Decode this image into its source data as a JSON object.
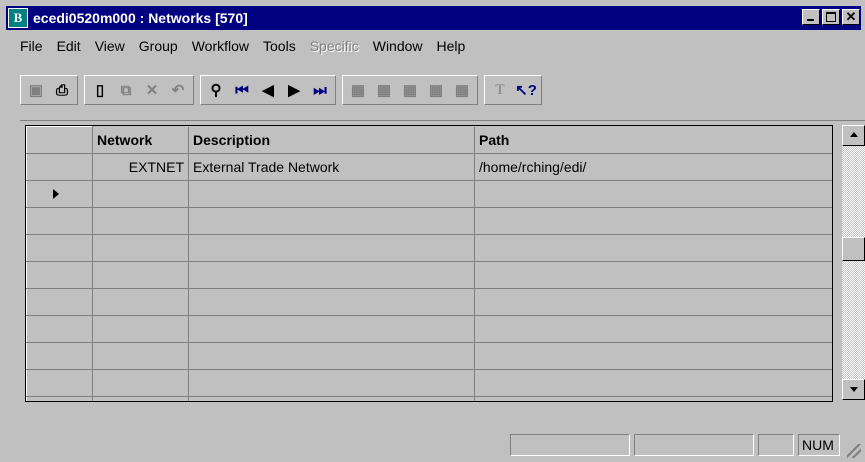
{
  "window": {
    "app_icon": "B",
    "title": "ecedi0520m000 : Networks [570]"
  },
  "menu": [
    {
      "label": "File",
      "enabled": true
    },
    {
      "label": "Edit",
      "enabled": true
    },
    {
      "label": "View",
      "enabled": true
    },
    {
      "label": "Group",
      "enabled": true
    },
    {
      "label": "Workflow",
      "enabled": true
    },
    {
      "label": "Tools",
      "enabled": true
    },
    {
      "label": "Specific",
      "enabled": false
    },
    {
      "label": "Window",
      "enabled": true
    },
    {
      "label": "Help",
      "enabled": true
    }
  ],
  "toolbar": {
    "icons": [
      "save-icon",
      "print-icon",
      "new-icon",
      "copy-icon",
      "delete-icon",
      "undo-icon",
      "find-icon",
      "first-record-icon",
      "previous-record-icon",
      "next-record-icon",
      "last-record-icon",
      "group-first-icon",
      "group-prev-icon",
      "group-icon",
      "group-next-icon",
      "group-last-icon",
      "text-icon",
      "context-help-icon"
    ]
  },
  "grid": {
    "columns": [
      "Network",
      "Description",
      "Path"
    ],
    "rows": [
      {
        "network": "EXTNET",
        "description": "External Trade Network",
        "path": "/home/rching/edi/"
      }
    ]
  },
  "statusbar": {
    "num": "NUM"
  },
  "colors": {
    "title_bar": "#000080",
    "face": "#c0c0c0"
  }
}
